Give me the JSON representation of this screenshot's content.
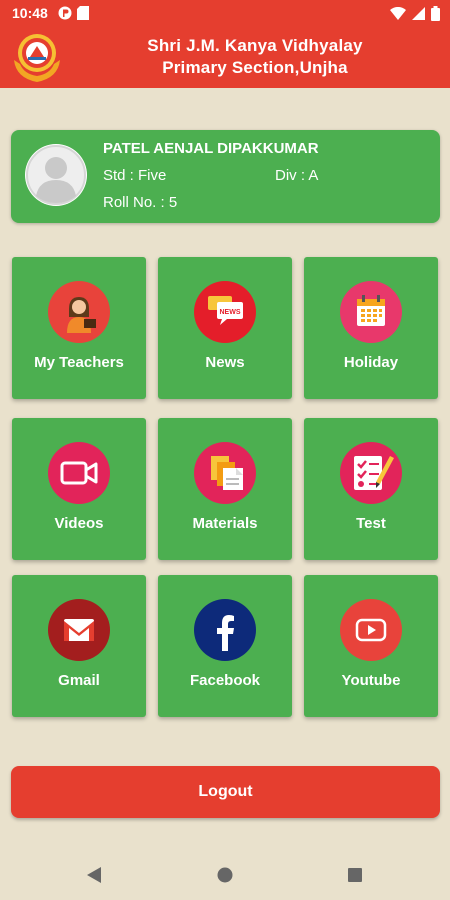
{
  "status_bar": {
    "time": "10:48"
  },
  "header": {
    "title_line1": "Shri J.M. Kanya Vidhyalay",
    "title_line2": "Primary Section,Unjha"
  },
  "profile": {
    "name": "PATEL AENJAL DIPAKKUMAR",
    "std": "Std : Five",
    "div": "Div : A",
    "roll": "Roll No. : 5"
  },
  "tiles": [
    {
      "label": "My Teachers",
      "icon": "teacher-icon"
    },
    {
      "label": "News",
      "icon": "news-icon"
    },
    {
      "label": "Holiday",
      "icon": "calendar-icon"
    },
    {
      "label": "Videos",
      "icon": "video-camera-icon"
    },
    {
      "label": "Materials",
      "icon": "documents-icon"
    },
    {
      "label": "Test",
      "icon": "test-checklist-icon"
    },
    {
      "label": "Gmail",
      "icon": "gmail-icon"
    },
    {
      "label": "Facebook",
      "icon": "facebook-icon"
    },
    {
      "label": "Youtube",
      "icon": "youtube-icon"
    }
  ],
  "logout_label": "Logout",
  "colors": {
    "primary_red": "#e53e2f",
    "tile_green": "#4caf50",
    "background": "#e9e1cc"
  }
}
